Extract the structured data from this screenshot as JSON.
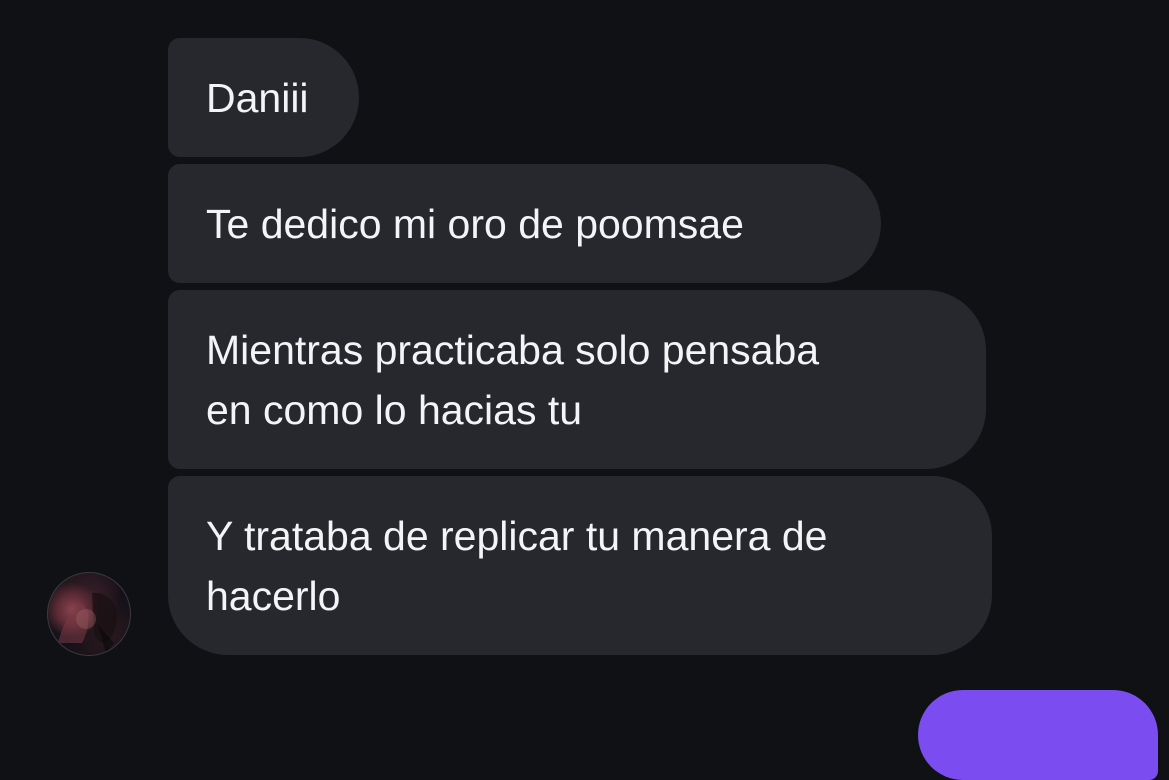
{
  "messages": [
    {
      "text": "Daniii"
    },
    {
      "text": "Te dedico mi oro de poomsae"
    },
    {
      "lines": [
        "Mientras practicaba solo pensaba",
        "en como lo hacias tu"
      ]
    },
    {
      "lines": [
        "Y trataba de replicar tu manera de",
        "hacerlo"
      ]
    }
  ],
  "colors": {
    "background": "#0f1115",
    "incoming_bubble": "#26282d",
    "outgoing_bubble": "#7b4df0",
    "text": "#f3f4f6"
  }
}
